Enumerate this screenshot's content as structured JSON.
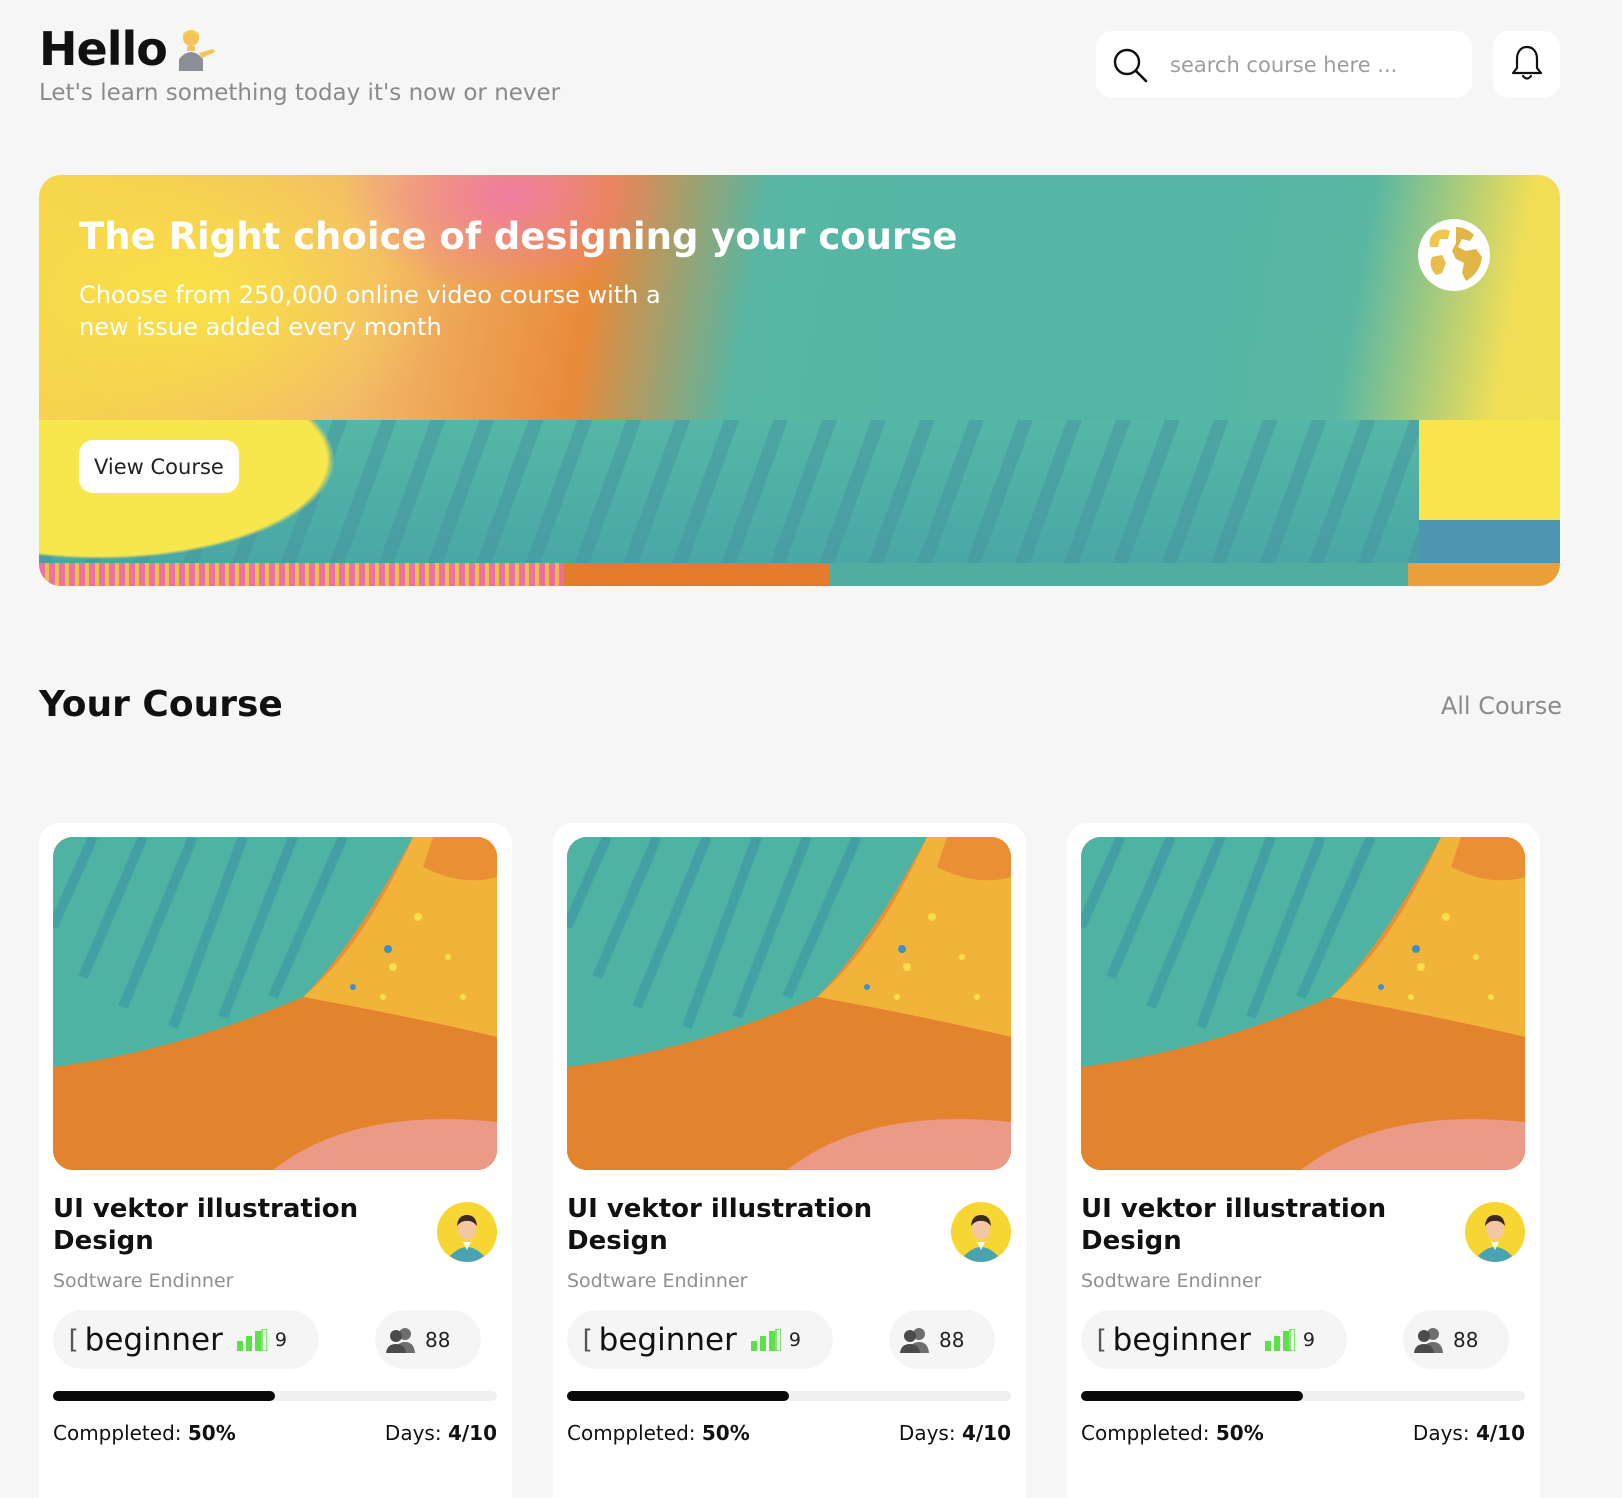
{
  "header": {
    "greeting": "Hello",
    "greeting_emoji": "person-tipping-hand",
    "subtitle": "Let's learn something today it's now or never"
  },
  "search": {
    "placeholder": "search course here ...",
    "value": ""
  },
  "icons": {
    "search": "search-icon",
    "notification": "bell-icon",
    "globe": "globe-icon",
    "level": "signal-bars-icon",
    "students": "people-icon"
  },
  "hero": {
    "title": "The Right choice of designing your course",
    "description": "Choose from 250,000 online video course with a new issue added every month",
    "button_label": "View Course"
  },
  "section": {
    "title": "Your Course",
    "link_label": "All Course"
  },
  "colors": {
    "background": "#f6f6f6",
    "card": "#ffffff",
    "progress": "#0a0a0a",
    "level_bars": "#5ee04a",
    "avatar_bg": "#f7d532"
  },
  "courses": [
    {
      "title": "UI vektor illustration Design",
      "author": "Sodtware Endinner",
      "level_bracket": "[",
      "level": "beginner",
      "lessons": "9",
      "students": "88",
      "progress": 0.5,
      "completed_label": "Comppleted:",
      "completed_value": "50%",
      "days_label": "Days:",
      "days_value": "4/10"
    },
    {
      "title": "UI vektor illustration Design",
      "author": "Sodtware Endinner",
      "level_bracket": "[",
      "level": "beginner",
      "lessons": "9",
      "students": "88",
      "progress": 0.5,
      "completed_label": "Comppleted:",
      "completed_value": "50%",
      "days_label": "Days:",
      "days_value": "4/10"
    },
    {
      "title": "UI vektor illustration Design",
      "author": "Sodtware Endinner",
      "level_bracket": "[",
      "level": "beginner",
      "lessons": "9",
      "students": "88",
      "progress": 0.5,
      "completed_label": "Comppleted:",
      "completed_value": "50%",
      "days_label": "Days:",
      "days_value": "4/10"
    }
  ]
}
